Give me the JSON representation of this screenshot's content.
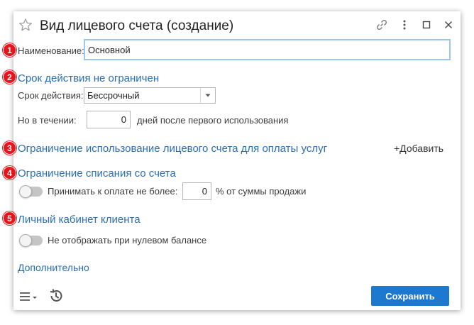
{
  "window": {
    "title": "Вид лицевого счета (создание)"
  },
  "markers": [
    "1",
    "2",
    "3",
    "4",
    "5"
  ],
  "fields": {
    "name_label": "Наименование:",
    "name_value": "Основной",
    "validity_section": "Срок действия не ограничен",
    "validity_label": "Срок действия:",
    "validity_value": "Бессрочный",
    "within_label": "Но в течении:",
    "within_value": "0",
    "within_suffix": "дней после первого использования"
  },
  "usage_restriction": {
    "section": "Ограничение использование лицевого счета для оплаты услуг",
    "add_label": "+Добавить"
  },
  "writeoff": {
    "section": "Ограничение списания со счета",
    "toggle_label": "Принимать к оплате не более:",
    "percent_value": "0",
    "percent_suffix": "% от суммы продажи"
  },
  "cabinet": {
    "section": "Личный кабинет клиента",
    "toggle_label": "Не отображать при нулевом балансе"
  },
  "more_link": "Дополнительно",
  "footer": {
    "save_label": "Сохранить"
  },
  "colors": {
    "accent": "#1c79cf",
    "link": "#2a6eb5",
    "marker": "#e8131b"
  }
}
